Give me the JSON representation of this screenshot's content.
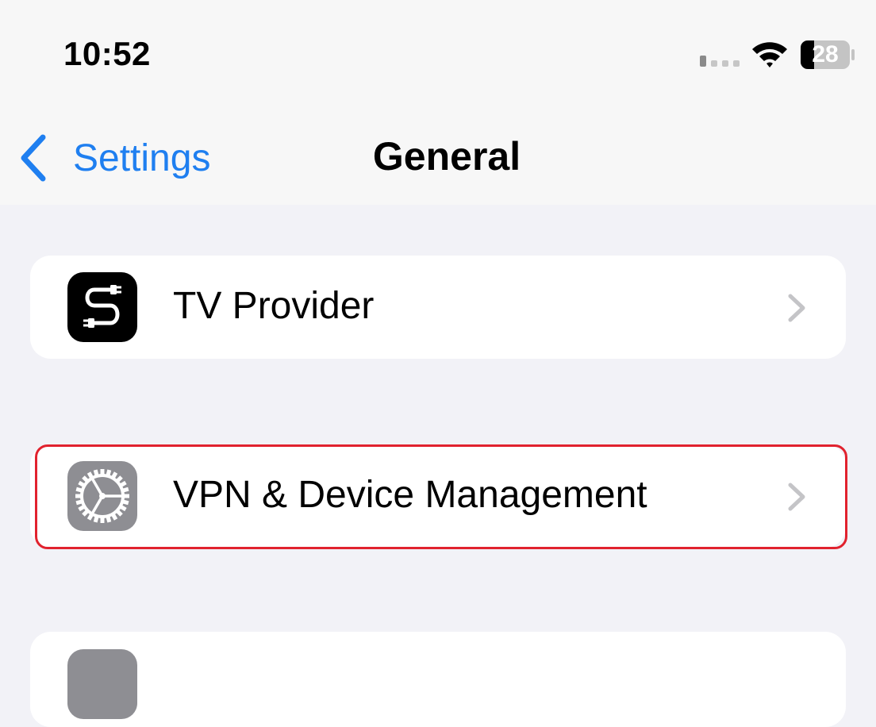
{
  "status_bar": {
    "time": "10:52",
    "battery_level": "28",
    "signal_icon": "cellular-signal-icon",
    "wifi_icon": "wifi-icon",
    "battery_icon": "battery-icon"
  },
  "nav": {
    "back_label": "Settings",
    "title": "General",
    "back_icon": "chevron-left-icon"
  },
  "rows": [
    {
      "label": "TV Provider",
      "icon": "tv-provider-icon"
    },
    {
      "label": "VPN & Device Management",
      "icon": "gear-icon"
    }
  ],
  "colors": {
    "accent": "#1f7ff0",
    "highlight": "#e1222e",
    "background": "#f2f2f7",
    "gear_icon_bg": "#8e8e93",
    "tv_icon_bg": "#000000"
  }
}
